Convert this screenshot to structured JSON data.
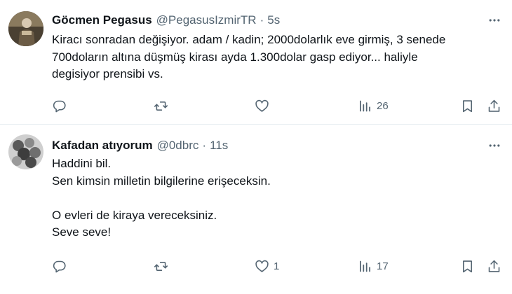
{
  "tweets": [
    {
      "name": "Göcmen Pegasus",
      "handle": "@PegasusIzmirTR",
      "separator": "·",
      "time": "5s",
      "text_lines": [
        "Kiracı sonradan değişiyor. adam / kadin; 2000dolarlık eve girmiş, 3 senede",
        "700doların altına düşmüş kirası ayda 1.300dolar gasp ediyor... haliyle",
        "degisiyor prensibi vs."
      ],
      "counts": {
        "reply": "",
        "retweet": "",
        "like": "",
        "views": "26"
      }
    },
    {
      "name": "Kafadan atıyorum",
      "handle": "@0dbrc",
      "separator": "·",
      "time": "11s",
      "text_lines": [
        "Haddini bil.",
        "Sen kimsin milletin bilgilerine erişeceksin.",
        "",
        "O evleri de kiraya vereceksiniz.",
        "Seve seve!"
      ],
      "counts": {
        "reply": "",
        "retweet": "",
        "like": "1",
        "views": "17"
      }
    }
  ],
  "icons": {
    "more": "more-horizontal-icon",
    "reply": "reply-icon",
    "retweet": "retweet-icon",
    "like": "heart-icon",
    "views": "views-icon",
    "bookmark": "bookmark-icon",
    "share": "share-icon"
  },
  "colors": {
    "text": "#0f1419",
    "muted": "#536471",
    "divider": "#e6ecf0"
  }
}
